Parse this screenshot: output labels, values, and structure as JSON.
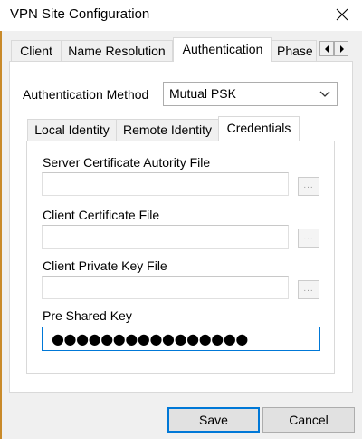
{
  "window": {
    "title": "VPN Site Configuration"
  },
  "tabs": [
    {
      "label": "Client",
      "active": false
    },
    {
      "label": "Name Resolution",
      "active": false
    },
    {
      "label": "Authentication",
      "active": true
    },
    {
      "label": "Phase",
      "active": false
    }
  ],
  "auth": {
    "method_label": "Authentication Method",
    "method_value": "Mutual PSK"
  },
  "inner_tabs": [
    {
      "label": "Local Identity",
      "active": false
    },
    {
      "label": "Remote Identity",
      "active": false
    },
    {
      "label": "Credentials",
      "active": true
    }
  ],
  "credentials": {
    "server_cert_label": "Server Certificate Autority File",
    "server_cert_value": "",
    "client_cert_label": "Client Certificate File",
    "client_cert_value": "",
    "private_key_label": "Client Private Key File",
    "private_key_value": "",
    "browse_label": "...",
    "psk_label": "Pre Shared Key",
    "psk_masked": "●●●●●●●●●●●●●●●●"
  },
  "buttons": {
    "save": "Save",
    "cancel": "Cancel"
  },
  "colors": {
    "focus": "#0078d7",
    "dialog_bg": "#f0f0f0"
  }
}
